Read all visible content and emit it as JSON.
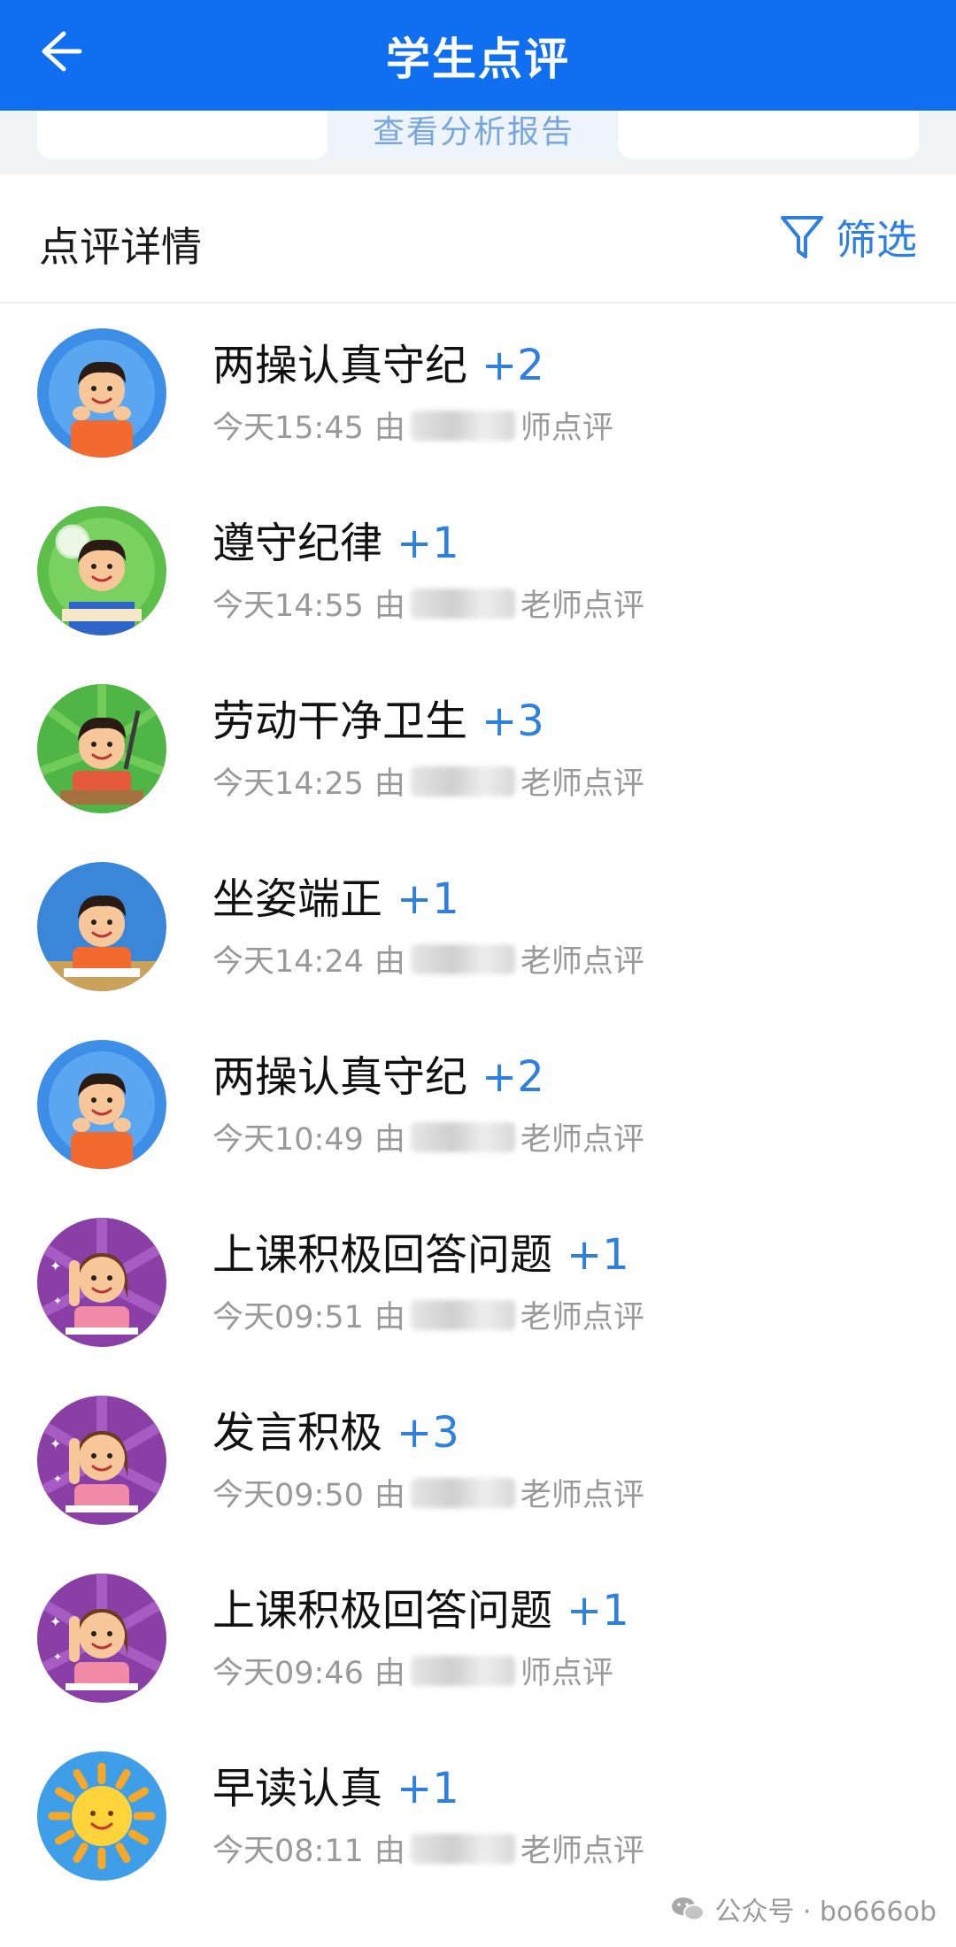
{
  "header": {
    "title": "学生点评"
  },
  "peek": {
    "center_label": "查看分析报告"
  },
  "section": {
    "title": "点评详情",
    "filter_label": "筛选"
  },
  "entries": [
    {
      "name": "两操认真守纪",
      "score": "+2",
      "time": "今天15:45",
      "by": "由",
      "suffix": "师点评",
      "avatar": "boy-blue"
    },
    {
      "name": "遵守纪律",
      "score": "+1",
      "time": "今天14:55",
      "by": "由",
      "suffix": "老师点评",
      "avatar": "boy-green"
    },
    {
      "name": "劳动干净卫生",
      "score": "+3",
      "time": "今天14:25",
      "by": "由",
      "suffix": "老师点评",
      "avatar": "boy-green-broom"
    },
    {
      "name": "坐姿端正",
      "score": "+1",
      "time": "今天14:24",
      "by": "由",
      "suffix": "老师点评",
      "avatar": "boy-blue-desk"
    },
    {
      "name": "两操认真守纪",
      "score": "+2",
      "time": "今天10:49",
      "by": "由",
      "suffix": "老师点评",
      "avatar": "boy-blue"
    },
    {
      "name": "上课积极回答问题",
      "score": "+1",
      "time": "今天09:51",
      "by": "由",
      "suffix": "老师点评",
      "avatar": "girl-purple"
    },
    {
      "name": "发言积极",
      "score": "+3",
      "time": "今天09:50",
      "by": "由",
      "suffix": "老师点评",
      "avatar": "girl-purple"
    },
    {
      "name": "上课积极回答问题",
      "score": "+1",
      "time": "今天09:46",
      "by": "由",
      "suffix": "师点评",
      "avatar": "girl-purple"
    },
    {
      "name": "早读认真",
      "score": "+1",
      "time": "今天08:11",
      "by": "由",
      "suffix": "老师点评",
      "avatar": "sun-blue"
    }
  ],
  "watermark": {
    "text": "公众号 · bo666ob"
  },
  "colors": {
    "header": "#0f6ff0",
    "accent": "#2f7fe0"
  }
}
